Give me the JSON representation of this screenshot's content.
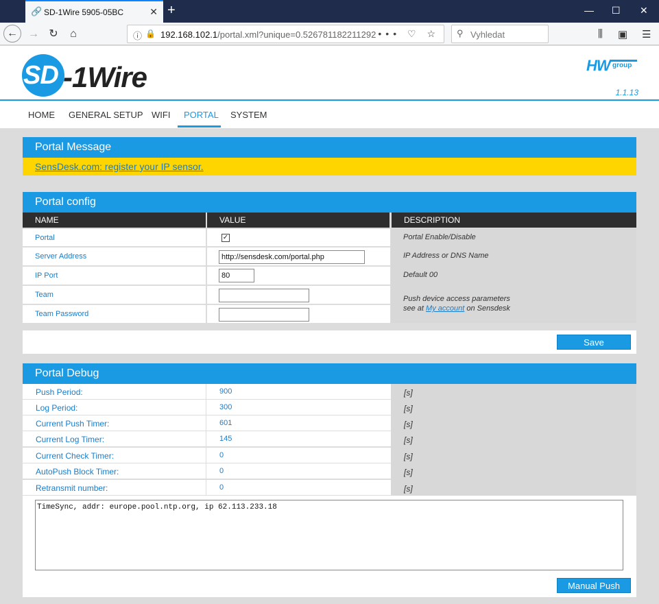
{
  "browser": {
    "tab_title": "SD-1Wire 5905-05BC",
    "url_host": "192.168.102.1",
    "url_path": "/portal.xml?unique=0.526781182211292",
    "search_placeholder": "Vyhledat"
  },
  "header": {
    "logo_sd": "SD",
    "logo_rest": "-1Wire",
    "brand_hw": "HW",
    "brand_group": "group",
    "version": "1.1.13"
  },
  "menu": {
    "items": [
      "HOME",
      "GENERAL SETUP",
      "WIFI",
      "PORTAL",
      "SYSTEM"
    ],
    "active": "PORTAL"
  },
  "portal_message": {
    "title": "Portal Message",
    "link_text": "SensDesk.com: register your IP sensor."
  },
  "portal_config": {
    "title": "Portal config",
    "columns": [
      "NAME",
      "VALUE",
      "DESCRIPTION"
    ],
    "rows": [
      {
        "name": "Portal",
        "description": "Portal Enable/Disable"
      },
      {
        "name": "Server Address",
        "value": "http://sensdesk.com/portal.php",
        "description": "IP Address or DNS Name"
      },
      {
        "name": "IP Port",
        "value": "80",
        "description": "Default 00"
      },
      {
        "name": "Team",
        "value": ""
      },
      {
        "name": "Team Password",
        "value": ""
      }
    ],
    "team_desc_line1": "Push device access parameters",
    "team_desc_prefix": "see at ",
    "team_desc_link": "My account",
    "team_desc_suffix": " on Sensdesk",
    "portal_checked": true,
    "save_label": "Save"
  },
  "portal_debug": {
    "title": "Portal Debug",
    "rows": [
      {
        "label": "Push Period:",
        "value": "900",
        "unit": "[s]"
      },
      {
        "label": "Log Period:",
        "value": "300",
        "unit": "[s]"
      },
      {
        "label": "Current Push Timer:",
        "value": "601",
        "unit": "[s]"
      },
      {
        "label": "Current Log Timer:",
        "value": "145",
        "unit": "[s]"
      },
      {
        "label": "Current Check Timer:",
        "value": "0",
        "unit": "[s]"
      },
      {
        "label": "AutoPush Block Timer:",
        "value": "0",
        "unit": "[s]"
      },
      {
        "label": "Retransmit number:",
        "value": "0",
        "unit": "[s]"
      }
    ],
    "log_text": "TimeSync, addr: europe.pool.ntp.org, ip 62.113.233.18",
    "manual_push_label": "Manual Push"
  }
}
